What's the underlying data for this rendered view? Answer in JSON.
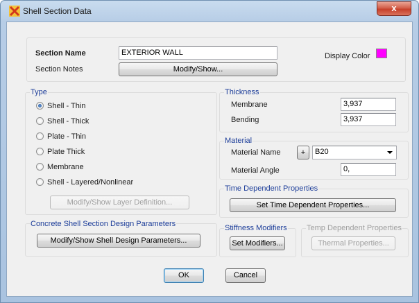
{
  "window": {
    "title": "Shell Section Data",
    "close_glyph": "x"
  },
  "section": {
    "name_label": "Section Name",
    "name_value": "EXTERIOR WALL",
    "notes_label": "Section Notes",
    "notes_button": "Modify/Show...",
    "display_color_label": "Display Color",
    "display_color": "#ff00ff"
  },
  "type": {
    "title": "Type",
    "options": [
      "Shell - Thin",
      "Shell - Thick",
      "Plate - Thin",
      "Plate Thick",
      "Membrane",
      "Shell - Layered/Nonlinear"
    ],
    "selected": "Shell - Thin",
    "layer_button": "Modify/Show Layer Definition..."
  },
  "thickness": {
    "title": "Thickness",
    "membrane_label": "Membrane",
    "membrane_value": "3,937",
    "bending_label": "Bending",
    "bending_value": "3,937"
  },
  "material": {
    "title": "Material",
    "name_label": "Material Name",
    "add_button": "+",
    "name_value": "B20",
    "angle_label": "Material Angle",
    "angle_value": "0,"
  },
  "time_dependent": {
    "title": "Time Dependent Properties",
    "button": "Set Time Dependent Properties..."
  },
  "concrete": {
    "title": "Concrete Shell Section Design Parameters",
    "button": "Modify/Show Shell Design Parameters..."
  },
  "stiffness": {
    "title": "Stiffness Modifiers",
    "button": "Set Modifiers..."
  },
  "temp_dependent": {
    "title": "Temp Dependent Properties",
    "button": "Thermal Properties..."
  },
  "footer": {
    "ok": "OK",
    "cancel": "Cancel"
  }
}
